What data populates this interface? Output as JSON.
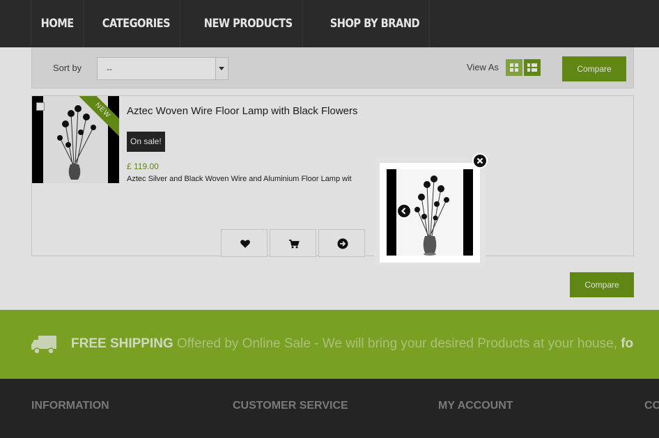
{
  "nav": {
    "items": [
      "HOME",
      "CATEGORIES",
      "NEW PRODUCTS",
      "SHOP BY BRAND"
    ]
  },
  "toolbar": {
    "sort_label": "Sort by",
    "sort_value": "--",
    "view_label": "View As",
    "compare_label": "Compare"
  },
  "product": {
    "badge": "NEW",
    "title": "Aztec Woven Wire Floor Lamp with Black Flowers",
    "sale_label": "On sale!",
    "price": "£ 119.00",
    "description": "Aztec Silver and Black Woven Wire and Aluminium Floor Lamp wit"
  },
  "bottom": {
    "compare_label": "Compare"
  },
  "shipping": {
    "strong": "FREE SHIPPING",
    "text": " Offered by Online Sale - We will bring your desired Products at your house, ",
    "tail": "fo"
  },
  "footer": {
    "headings": [
      "INFORMATION",
      "CUSTOMER SERVICE",
      "MY ACCOUNT",
      "CO"
    ]
  },
  "colors": {
    "accent": "#6e9a16",
    "nav_bg": "#2a2a2a",
    "shipping_bg": "#8ab528"
  },
  "icons": {
    "wishlist": "heart-icon",
    "cart": "cart-icon",
    "details": "arrow-right-icon",
    "close": "close-icon",
    "prev": "chevron-left-icon",
    "truck": "truck-icon"
  }
}
